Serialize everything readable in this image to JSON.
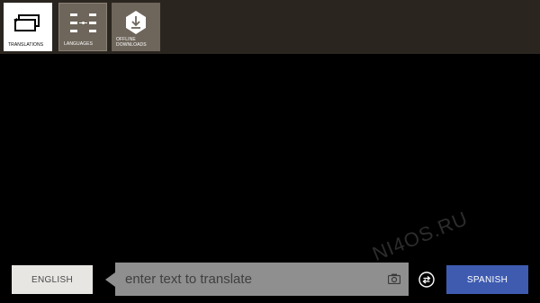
{
  "tabs": [
    {
      "label": "TRANSLATIONS",
      "icon": "translations-icon",
      "selected": true
    },
    {
      "label": "LANGUAGES",
      "icon": "languages-icon",
      "selected": false
    },
    {
      "label": "OFFLINE DOWNLOADS",
      "icon": "download-icon",
      "selected": false
    }
  ],
  "translator": {
    "source_language": "ENGLISH",
    "target_language": "SPANISH",
    "input_placeholder": "enter text to translate",
    "camera_icon": "camera-icon",
    "swap_icon": "swap-icon"
  },
  "watermark": "NI4OS.RU",
  "colors": {
    "topbar": "#2a251f",
    "tile_inactive": "#6e665b",
    "accent": "#3e5bb0",
    "input_bg": "#8f8f8f",
    "source_btn": "#e8e6e3"
  }
}
